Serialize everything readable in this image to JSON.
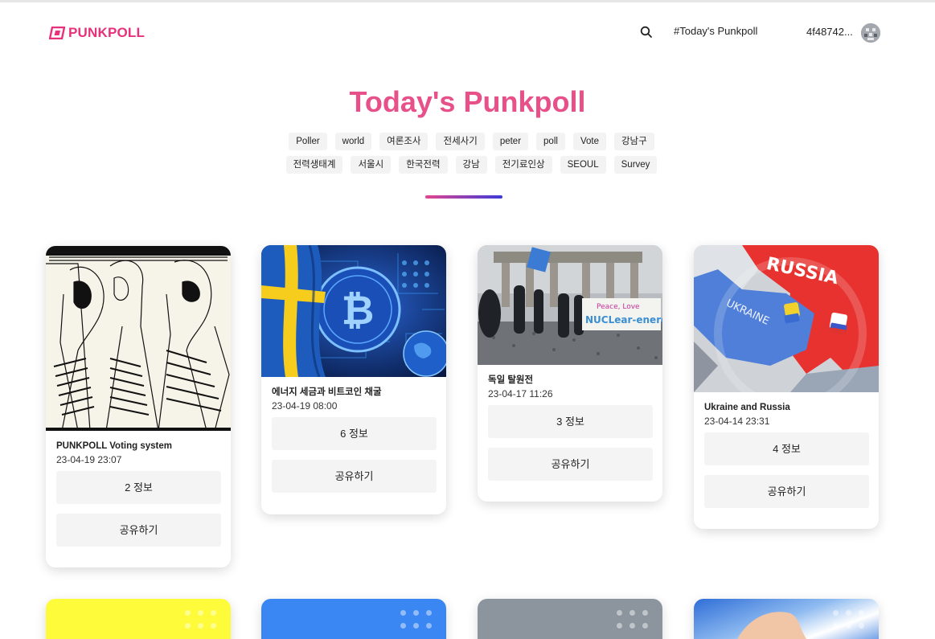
{
  "brand": {
    "name": "PUNKPOLL",
    "color": "#e8307b"
  },
  "header": {
    "search_icon": "search-icon",
    "today_link": "#Today's Punkpoll",
    "wallet_address": "4f48742...",
    "avatar_icon": "avatar-icon"
  },
  "hero": {
    "title": "Today's Punkpoll",
    "tags_row1": [
      "Poller",
      "world",
      "여론조사",
      "전세사기",
      "peter",
      "poll",
      "Vote",
      "강남구"
    ],
    "tags_row2": [
      "전력생태계",
      "서울시",
      "한국전력",
      "강남",
      "전기료인상",
      "SEOUL",
      "Survey"
    ]
  },
  "cards": [
    {
      "title": "PUNKPOLL Voting system",
      "date": "23-04-19 23:07",
      "info_label": "2 정보",
      "share_label": "공유하기"
    },
    {
      "title": "에너지 세금과 비트코인 채굴",
      "date": "23-04-19 08:00",
      "info_label": "6 정보",
      "share_label": "공유하기"
    },
    {
      "title": "독일 탈원전",
      "date": "23-04-17 11:26",
      "info_label": "3 정보",
      "share_label": "공유하기",
      "image_text": {
        "peace": "Peace, Love",
        "nuclear": "NUCLear-energy"
      }
    },
    {
      "title": "Ukraine and Russia",
      "date": "23-04-14 23:31",
      "info_label": "4 정보",
      "share_label": "공유하기",
      "image_text": {
        "russia": "RUSSIA",
        "ukraine": "UKRAINE"
      }
    }
  ],
  "colors": {
    "accent_pink": "#e8508a",
    "divider_start": "#e2458f",
    "divider_end": "#3b3bd8",
    "card_yellow": "#fdfb3a",
    "card_blue": "#3a86f2",
    "card_gray": "#8c959e"
  }
}
